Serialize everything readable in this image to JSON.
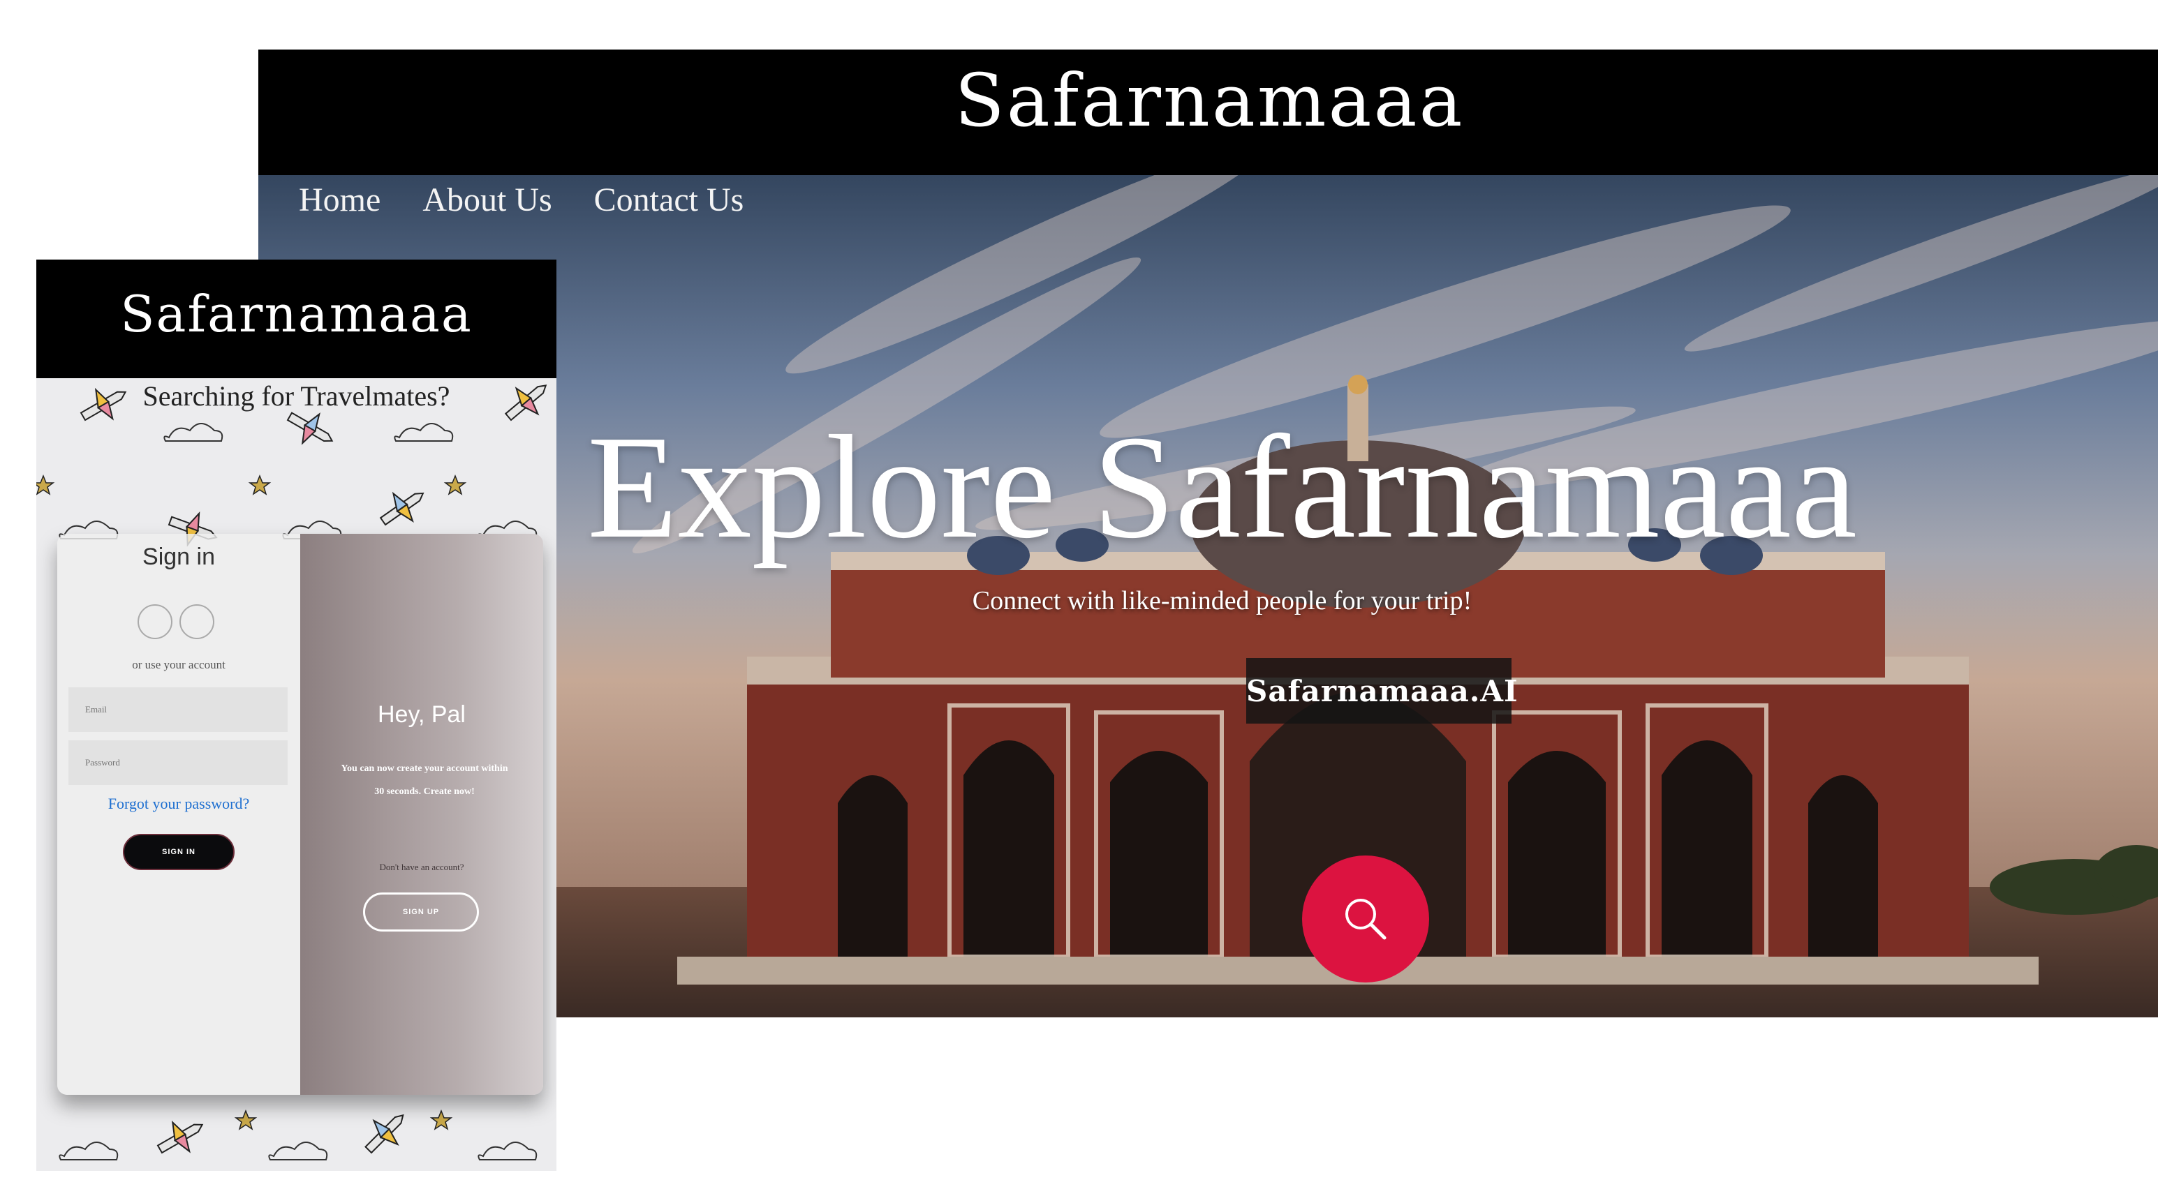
{
  "desktop": {
    "brand": "Safarnamaaa",
    "nav": [
      "Home",
      "About Us",
      "Contact Us"
    ],
    "hero_title": "Explore Safarnamaaa",
    "hero_subtitle": "Connect with like-minded people for your trip!",
    "ai_button": "Safarnamaaa.AI",
    "search_icon": "search-icon",
    "accent_color": "#dc1340"
  },
  "mobile": {
    "brand": "Safarnamaaa",
    "headline": "Searching for Travelmates?",
    "signin": {
      "title": "Sign in",
      "or_text": "or use your account",
      "email_placeholder": "Email",
      "password_placeholder": "Password",
      "forgot": "Forgot your password?",
      "button": "SIGN IN"
    },
    "signup": {
      "title": "Hey, Pal",
      "body": "You can now create your account within 30 seconds. Create now!",
      "question": "Don't have an account?",
      "button": "SIGN UP"
    }
  }
}
